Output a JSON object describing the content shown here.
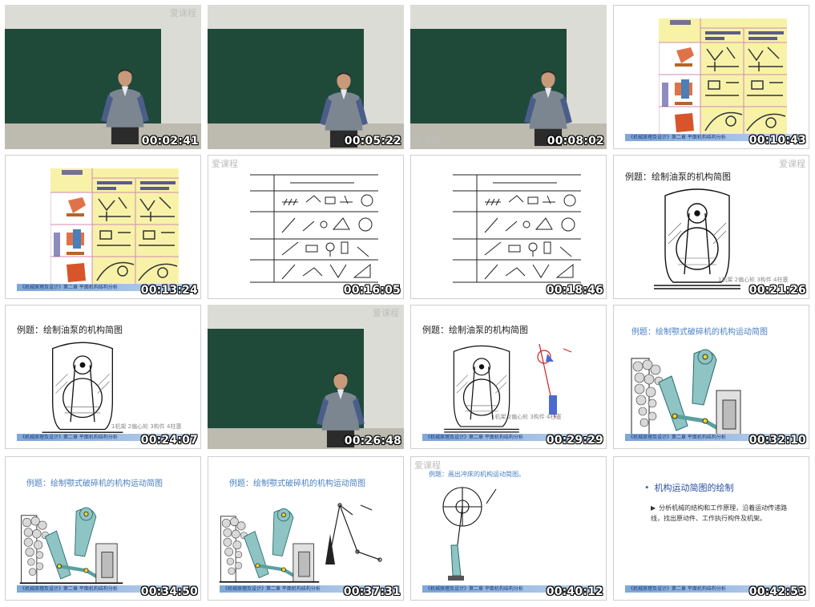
{
  "watermark": "爱课程",
  "footer_text": "《机械原理及设计》第二章  平面机构结构分析",
  "slide_titles": {
    "pump": "例题：绘制油泵的机构简图",
    "crusher": "例题：绘制颚式破碎机的机构运动简图",
    "punch": "例题：画出冲床的机构运动简图。"
  },
  "figure_labels": {
    "pump_ticks": "1机架  2偏心轮  3构件  4柱塞"
  },
  "final_slide": {
    "heading": "机构运动简图的绘制",
    "bullet_marker": "•",
    "body_marker": "▶",
    "body": "分析机械的结构和工作原理，沿着运动传递路线，找出原动件、工作执行构件及机架。"
  },
  "thumbnails": [
    {
      "kind": "video",
      "timestamp": "00:02:41"
    },
    {
      "kind": "video",
      "timestamp": "00:05:22"
    },
    {
      "kind": "video",
      "timestamp": "00:08:02"
    },
    {
      "kind": "table-slide",
      "timestamp": "00:10:43"
    },
    {
      "kind": "table-slide",
      "timestamp": "00:13:24"
    },
    {
      "kind": "symbol-slide",
      "timestamp": "00:16:05"
    },
    {
      "kind": "symbol-slide",
      "timestamp": "00:18:46"
    },
    {
      "kind": "pump-slide",
      "timestamp": "00:21:26"
    },
    {
      "kind": "pump-slide",
      "timestamp": "00:24:07"
    },
    {
      "kind": "video",
      "timestamp": "00:26:48"
    },
    {
      "kind": "pump-diagram-slide",
      "timestamp": "00:29:29"
    },
    {
      "kind": "crusher-slide",
      "timestamp": "00:32:10"
    },
    {
      "kind": "crusher-slide",
      "timestamp": "00:34:50"
    },
    {
      "kind": "crusher-diagram-slide",
      "timestamp": "00:37:31"
    },
    {
      "kind": "punch-slide",
      "timestamp": "00:40:12"
    },
    {
      "kind": "text-slide",
      "timestamp": "00:42:53"
    }
  ]
}
